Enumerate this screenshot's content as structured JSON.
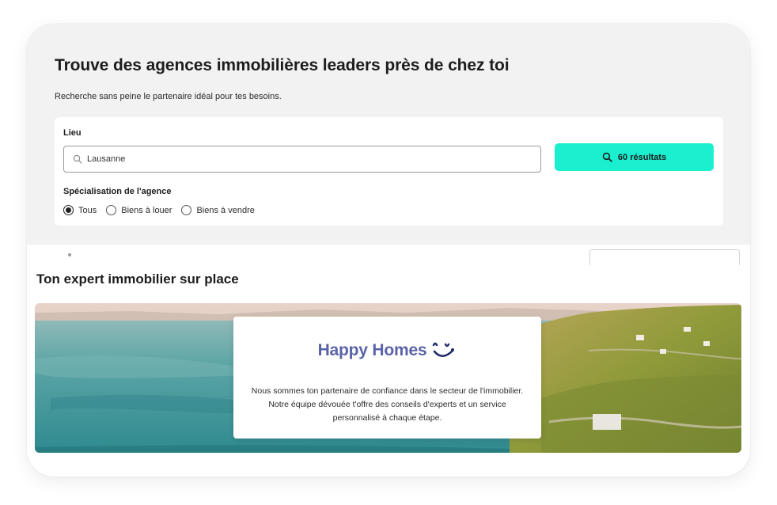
{
  "search": {
    "title": "Trouve des agences immobilières leaders près de chez toi",
    "subtitle": "Recherche sans peine le partenaire idéal pour tes besoins.",
    "location_label": "Lieu",
    "location_value": "Lausanne",
    "results_button": "60 résultats",
    "specialization_label": "Spécialisation de l'agence",
    "options": [
      {
        "label": "Tous",
        "checked": true
      },
      {
        "label": "Biens à louer",
        "checked": false
      },
      {
        "label": "Biens à vendre",
        "checked": false
      }
    ]
  },
  "expert": {
    "title": "Ton expert immobilier sur place",
    "brand_name": "Happy Homes",
    "description": "Nous sommes ton partenaire de confiance dans le secteur de l'immobilier. Notre équipe dévouée t'offre des conseils d'experts et un service personnalisé à chaque étape."
  },
  "colors": {
    "accent": "#1af0cf",
    "brand": "#5a63a8",
    "lake": "#3f9a9b",
    "vineyard": "#9b9a3c"
  },
  "icons": {
    "search": "search-icon",
    "brand_logo": "smile-logo-icon"
  }
}
